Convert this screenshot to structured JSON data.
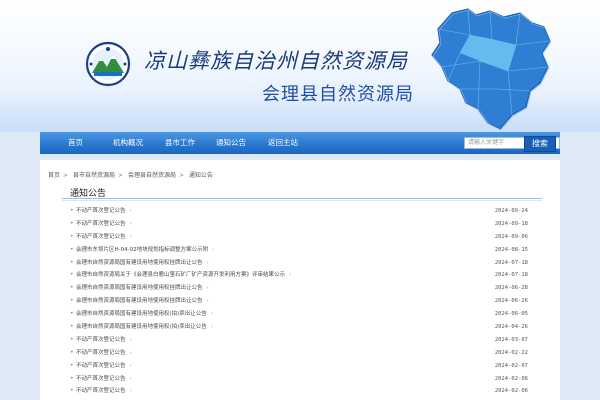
{
  "header": {
    "title": "凉山彝族自治州自然资源局",
    "subtitle": "会理县自然资源局"
  },
  "nav": {
    "items": [
      "首页",
      "机构概况",
      "县市工作",
      "通知公告",
      "返回主站"
    ],
    "search_placeholder": "请输入关键字",
    "search_button": "搜索"
  },
  "breadcrumb": [
    "首页",
    "县市自然资源局",
    "会理县自然资源局",
    "通知公告"
  ],
  "section": {
    "title": "通知公告"
  },
  "notices": [
    {
      "title": "不动产首次登记公告",
      "date": "2024-09-24"
    },
    {
      "title": "不动产首次登记公告",
      "date": "2024-09-18"
    },
    {
      "title": "不动产首次登记公告",
      "date": "2024-09-06"
    },
    {
      "title": "会理市东坝片区H-04-02地块规划指标调整方案公示附",
      "date": "2024-08-15"
    },
    {
      "title": "会理市自然资源局国有建设用地使用权挂牌出让公告",
      "date": "2024-07-18"
    },
    {
      "title": "会理市自然资源局关于《会理县白鹿山萤石矿厂矿产资源开发利用方案》评审结果公示",
      "date": "2024-07-18"
    },
    {
      "title": "会理市自然资源局国有建设用地使用权挂牌出让公告",
      "date": "2024-06-28"
    },
    {
      "title": "会理市自然资源局国有建设用地使用权挂牌出让公告",
      "date": "2024-06-26"
    },
    {
      "title": "会理市自然资源局国有建设用地使用权(拍)卖出让公告",
      "date": "2024-06-05"
    },
    {
      "title": "会理市自然资源局国有建设用地使用权(拍)卖出让公告",
      "date": "2024-04-26"
    },
    {
      "title": "不动产首次登记公告",
      "date": "2024-03-07"
    },
    {
      "title": "不动产首次登记公告",
      "date": "2024-02-22"
    },
    {
      "title": "不动产首次登记公告",
      "date": "2024-02-07"
    },
    {
      "title": "不动产首次登记公告",
      "date": "2024-02-06"
    },
    {
      "title": "不动产首次登记公告",
      "date": "2024-02-06"
    }
  ],
  "colors": {
    "nav_blue": "#2a78cf",
    "title_blue": "#1e4fa6",
    "search_button": "#1b5eb6"
  }
}
